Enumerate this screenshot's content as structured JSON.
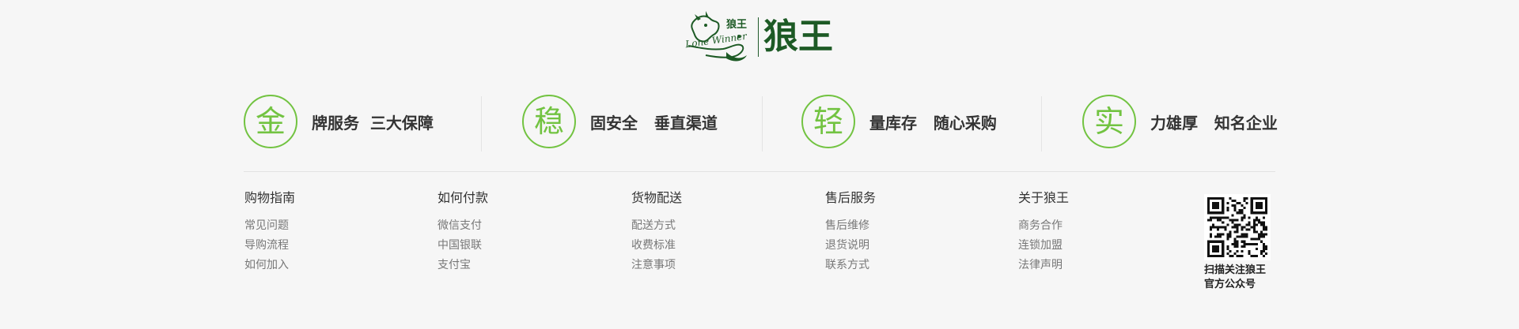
{
  "logo": {
    "emblem_text": "狼王",
    "emblem_script": "Lone Winner",
    "wordmark": "狼王",
    "brand_color": "#1d5a25"
  },
  "features": [
    {
      "char": "金",
      "text": "牌服务  三大保障"
    },
    {
      "char": "稳",
      "text": "固安全   垂直渠道"
    },
    {
      "char": "轻",
      "text": "量库存   随心采购"
    },
    {
      "char": "实",
      "text": "力雄厚   知名企业"
    }
  ],
  "accent_color": "#72c341",
  "footer": {
    "columns": [
      {
        "title": "购物指南",
        "links": [
          "常见问题",
          "导购流程",
          "如何加入"
        ]
      },
      {
        "title": "如何付款",
        "links": [
          "微信支付",
          "中国银联",
          "支付宝"
        ]
      },
      {
        "title": "货物配送",
        "links": [
          "配送方式",
          "收费标准",
          "注意事项"
        ]
      },
      {
        "title": "售后服务",
        "links": [
          "售后维修",
          "退货说明",
          "联系方式"
        ]
      },
      {
        "title": "关于狼王",
        "links": [
          "商务合作",
          "连锁加盟",
          "法律声明"
        ]
      }
    ],
    "qr": {
      "icon": "qr-code-icon",
      "caption_line1": "扫描关注狼王",
      "caption_line2": "官方公众号"
    }
  }
}
